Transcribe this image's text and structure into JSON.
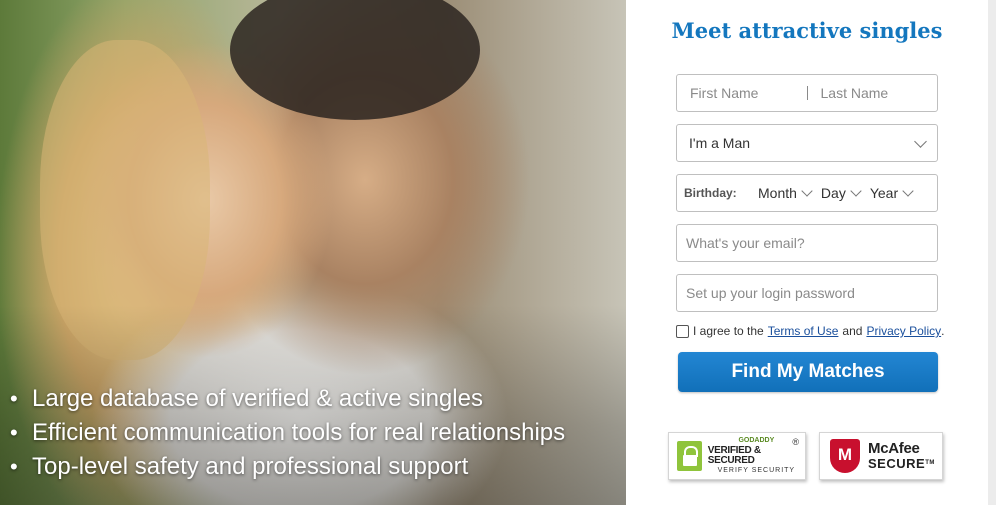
{
  "hero": {
    "bullets": [
      "Large database of verified & active singles",
      "Efficient communication tools for real relationships",
      "Top-level safety and professional support"
    ],
    "bullet_char": "•"
  },
  "form": {
    "title": "Meet attractive singles",
    "first_name_placeholder": "First Name",
    "last_name_placeholder": "Last Name",
    "gender_value": "I'm a Man",
    "birthday_label": "Birthday:",
    "month": "Month",
    "day": "Day",
    "year": "Year",
    "email_placeholder": "What's your email?",
    "password_placeholder": "Set up your login password",
    "agree_text": "I agree to the",
    "terms_link": "Terms of Use",
    "and_text": "and",
    "privacy_link": "Privacy Policy",
    "period": ".",
    "submit": "Find My Matches"
  },
  "badges": {
    "godaddy_top": "GODADDY",
    "godaddy_mid": "VERIFIED & SECURED",
    "godaddy_bot": "VERIFY SECURITY",
    "godaddy_reg": "®",
    "mcafee_letter": "M",
    "mcafee_name": "McAfee",
    "mcafee_secure": "SECURE",
    "mcafee_tm": "TM"
  },
  "colors": {
    "accent": "#1477be",
    "button": "#1170b9",
    "godaddy_green": "#8fc43c",
    "mcafee_red": "#c8102e"
  }
}
